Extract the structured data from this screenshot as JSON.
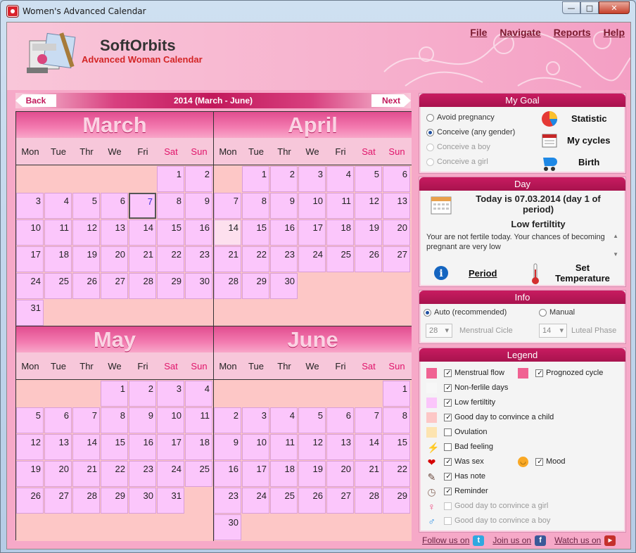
{
  "window": {
    "title": "Women's Advanced Calendar"
  },
  "brand": {
    "name": "SoftOrbits",
    "product": "Advanced Woman Calendar"
  },
  "menu": [
    "File",
    "Navigate",
    "Reports",
    "Help"
  ],
  "nav": {
    "back": "Back",
    "next": "Next",
    "range": "2014 (March - June)"
  },
  "weekdays": [
    "Mon",
    "Tue",
    "Thr",
    "We",
    "Fri",
    "Sat",
    "Sun"
  ],
  "months": [
    {
      "name": "March",
      "offset": 5,
      "days": 31,
      "today": 7,
      "selected": null
    },
    {
      "name": "April",
      "offset": 1,
      "days": 30,
      "today": null,
      "selected": 14
    },
    {
      "name": "May",
      "offset": 3,
      "days": 31,
      "today": null,
      "selected": null
    },
    {
      "name": "June",
      "offset": 6,
      "days": 30,
      "today": null,
      "selected": null
    }
  ],
  "goal": {
    "title": "My Goal",
    "options": [
      {
        "label": "Avoid pregnancy",
        "checked": false,
        "enabled": true
      },
      {
        "label": "Conceive (any gender)",
        "checked": true,
        "enabled": true
      },
      {
        "label": "Conceive a boy",
        "checked": false,
        "enabled": false
      },
      {
        "label": "Conceive a girl",
        "checked": false,
        "enabled": false
      }
    ],
    "links": [
      "Statistic",
      "My cycles",
      "Birth"
    ]
  },
  "day": {
    "title": "Day",
    "today_line1": "Today is 07.03.2014 (day 1 of",
    "today_line2": "period)",
    "fertility": "Low fertiltity",
    "note_line1": "Your are not fertile today. Your chances of becoming",
    "note_line2": "pregnant are very low",
    "period": "Period",
    "set": "Set",
    "temperature": "Temperature"
  },
  "info": {
    "title": "Info",
    "auto": "Auto (recommended)",
    "manual": "Manual",
    "cycle_value": "28",
    "cycle_label": "Menstrual Cicle",
    "luteal_value": "14",
    "luteal_label": "Luteal Phase"
  },
  "legend": {
    "title": "Legend",
    "items": [
      {
        "label": "Menstrual flow",
        "checked": true,
        "color": "#f06292",
        "enabled": true
      },
      {
        "label": "Non-ferlile days",
        "checked": true,
        "color": "#f7f7f7",
        "enabled": true
      },
      {
        "label": "Low fertiltity",
        "checked": true,
        "color": "#fbc6fb",
        "enabled": true
      },
      {
        "label": "Good day to convince a child",
        "checked": true,
        "color": "#fdc7c6",
        "enabled": true
      },
      {
        "label": "Ovulation",
        "checked": false,
        "color": "#fde4b0",
        "enabled": true
      },
      {
        "label": "Bad feeling",
        "checked": false,
        "icon": "lightning-icon",
        "enabled": true
      },
      {
        "label": "Was sex",
        "checked": true,
        "icon": "heart-icon",
        "enabled": true
      },
      {
        "label": "Has note",
        "checked": true,
        "icon": "note-icon",
        "enabled": true
      },
      {
        "label": "Reminder",
        "checked": true,
        "icon": "clock-icon",
        "enabled": true
      },
      {
        "label": "Good day to convince a girl",
        "checked": false,
        "icon": "girl-icon",
        "enabled": false
      },
      {
        "label": "Good day to convince a boy",
        "checked": false,
        "icon": "boy-icon",
        "enabled": false
      }
    ],
    "prognozed": {
      "label": "Prognozed cycle",
      "checked": true,
      "color": "#f06292"
    },
    "mood": {
      "label": "Mood",
      "checked": true
    }
  },
  "footer": {
    "follow": "Follow us on",
    "join": "Join us on",
    "watch": "Watch us on"
  }
}
